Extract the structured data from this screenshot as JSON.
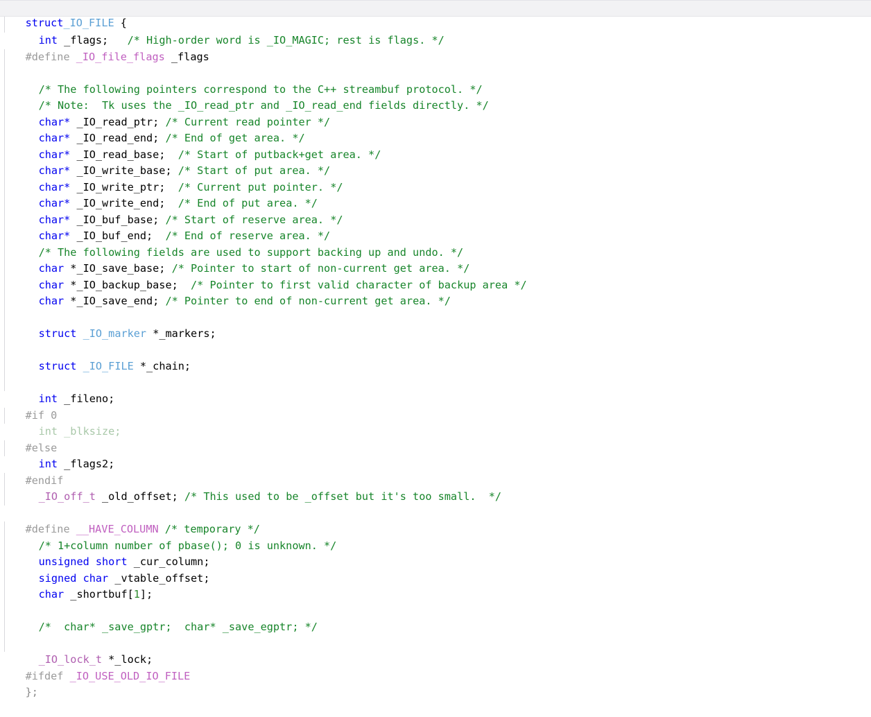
{
  "editor": {
    "language": "C",
    "background": "#ffffff",
    "current_line_highlight": "#f2f2f4",
    "indent_guide_color": "#d8d8dc"
  },
  "palette": {
    "keyword": "#0000f0",
    "type": "#5a9fd4",
    "typedef": "#b05fb0",
    "macro": "#c060c0",
    "preprocessor": "#9a9a9a",
    "comment": "#17852a",
    "identifier": "#000000",
    "number": "#2e8b2e",
    "inactive_code": "#a9c8a9"
  },
  "code": {
    "l1": {
      "kw": "struct",
      "type": "_IO_FILE",
      "punct": " {"
    },
    "l2": {
      "kw": "int",
      "id": " _flags;",
      "gap": "   ",
      "cmt": "/* High-order word is _IO_MAGIC; rest is flags. */"
    },
    "l3": {
      "pp": "#define",
      "macro": " _IO_file_flags",
      "id": " _flags"
    },
    "l4": {
      "blank": ""
    },
    "l5": {
      "cmt": "/* The following pointers correspond to the C++ streambuf protocol. */"
    },
    "l6": {
      "cmt": "/* Note:  Tk uses the _IO_read_ptr and _IO_read_end fields directly. */"
    },
    "l7": {
      "kw": "char*",
      "id": " _IO_read_ptr; ",
      "cmt": "/* Current read pointer */"
    },
    "l8": {
      "kw": "char*",
      "id": " _IO_read_end; ",
      "cmt": "/* End of get area. */"
    },
    "l9": {
      "kw": "char*",
      "id": " _IO_read_base;  ",
      "cmt": "/* Start of putback+get area. */"
    },
    "l10": {
      "kw": "char*",
      "id": " _IO_write_base; ",
      "cmt": "/* Start of put area. */"
    },
    "l11": {
      "kw": "char*",
      "id": " _IO_write_ptr;  ",
      "cmt": "/* Current put pointer. */"
    },
    "l12": {
      "kw": "char*",
      "id": " _IO_write_end;  ",
      "cmt": "/* End of put area. */"
    },
    "l13": {
      "kw": "char*",
      "id": " _IO_buf_base; ",
      "cmt": "/* Start of reserve area. */"
    },
    "l14": {
      "kw": "char*",
      "id": " _IO_buf_end;  ",
      "cmt": "/* End of reserve area. */"
    },
    "l15": {
      "cmt": "/* The following fields are used to support backing up and undo. */"
    },
    "l16": {
      "kw": "char",
      "id": " *_IO_save_base; ",
      "cmt": "/* Pointer to start of non-current get area. */"
    },
    "l17": {
      "kw": "char",
      "id": " *_IO_backup_base;  ",
      "cmt": "/* Pointer to first valid character of backup area */"
    },
    "l18": {
      "kw": "char",
      "id": " *_IO_save_end; ",
      "cmt": "/* Pointer to end of non-current get area. */"
    },
    "l19": {
      "blank": ""
    },
    "l20": {
      "kw": "struct",
      "type": " _IO_marker",
      "id": " *_markers;"
    },
    "l21": {
      "blank": ""
    },
    "l22": {
      "kw": "struct",
      "type": " _IO_FILE",
      "id": " *_chain;"
    },
    "l23": {
      "blank": ""
    },
    "l24": {
      "kw": "int",
      "id": " _fileno;"
    },
    "l25": {
      "pp": "#if 0"
    },
    "l26": {
      "inactive": "int _blksize;"
    },
    "l27": {
      "pp": "#else"
    },
    "l28": {
      "kw": "int",
      "id": " _flags2;"
    },
    "l29": {
      "pp": "#endif"
    },
    "l30": {
      "tdef": "_IO_off_t",
      "id": " _old_offset; ",
      "cmt": "/* This used to be _offset but it's too small.  */"
    },
    "l31": {
      "blank": ""
    },
    "l32": {
      "pp": "#define",
      "macro": " __HAVE_COLUMN",
      "gap": " ",
      "cmt": "/* temporary */"
    },
    "l33": {
      "cmt": "/* 1+column number of pbase(); 0 is unknown. */"
    },
    "l34": {
      "kw": "unsigned short",
      "id": " _cur_column;"
    },
    "l35": {
      "kw": "signed char",
      "id": " _vtable_offset;"
    },
    "l36": {
      "kw": "char",
      "id": " _shortbuf[",
      "num": "1",
      "punct": "];"
    },
    "l37": {
      "blank": ""
    },
    "l38": {
      "cmt": "/*  char* _save_gptr;  char* _save_egptr; */"
    },
    "l39": {
      "blank": ""
    },
    "l40": {
      "tdef": "_IO_lock_t",
      "id": " *_lock;"
    },
    "l41": {
      "pp": "#ifdef",
      "macro": " _IO_USE_OLD_IO_FILE"
    },
    "l42": {
      "dim": "};"
    }
  }
}
